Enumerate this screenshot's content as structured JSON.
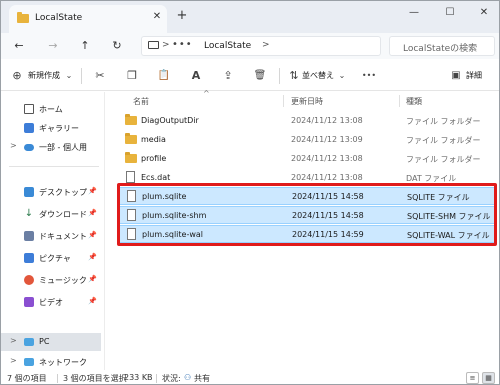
{
  "window": {
    "tab_title": "LocalState",
    "close_tab": "✕",
    "new_tab": "+",
    "minimize": "—",
    "maximize": "☐",
    "close": "✕"
  },
  "address": {
    "back": "←",
    "forward": "→",
    "up": "↑",
    "refresh": "↻",
    "overflow": "•••",
    "location": "LocalState",
    "chevron": ">",
    "search_placeholder": "LocalStateの検索"
  },
  "toolbar": {
    "new_label": "新規作成",
    "new_plus": "⊕",
    "new_caret": "⌄",
    "cut": "✂",
    "copy": "❐",
    "paste": "📋",
    "rename": "A",
    "share": "⇪",
    "delete": "🗑",
    "sort_label": "並べ替え",
    "sort_icon": "⇅",
    "more": "•••",
    "details_label": "詳細",
    "details_icon": "▣"
  },
  "sidebar": {
    "items": [
      {
        "label": "ホーム",
        "icon": "home-icon",
        "chev": ""
      },
      {
        "label": "ギャラリー",
        "icon": "gallery-icon",
        "chev": ""
      },
      {
        "label": "一部 - 個人用",
        "icon": "cloud-icon",
        "chev": ">"
      },
      {
        "label": "デスクトップ",
        "icon": "desktop-icon",
        "chev": ""
      },
      {
        "label": "ダウンロード",
        "icon": "download-icon",
        "chev": ""
      },
      {
        "label": "ドキュメント",
        "icon": "documents-icon",
        "chev": ""
      },
      {
        "label": "ピクチャ",
        "icon": "pictures-icon",
        "chev": ""
      },
      {
        "label": "ミュージック",
        "icon": "music-icon",
        "chev": ""
      },
      {
        "label": "ビデオ",
        "icon": "videos-icon",
        "chev": ""
      },
      {
        "label": "PC",
        "icon": "pc-icon",
        "chev": ">"
      },
      {
        "label": "ネットワーク",
        "icon": "network-icon",
        "chev": ">"
      }
    ],
    "pin": "📌"
  },
  "columns": {
    "name": "名前",
    "modified": "更新日時",
    "type": "種類",
    "sort_caret": "^"
  },
  "files": [
    {
      "name": "DiagOutputDir",
      "date": "2024/11/12 13:08",
      "type": "ファイル フォルダー",
      "kind": "folder"
    },
    {
      "name": "media",
      "date": "2024/11/12 13:09",
      "type": "ファイル フォルダー",
      "kind": "folder"
    },
    {
      "name": "profile",
      "date": "2024/11/12 13:08",
      "type": "ファイル フォルダー",
      "kind": "folder"
    },
    {
      "name": "Ecs.dat",
      "date": "2024/11/12 13:08",
      "type": "DAT ファイル",
      "kind": "file"
    },
    {
      "name": "plum.sqlite",
      "date": "2024/11/15 14:58",
      "type": "SQLITE ファイル",
      "kind": "file"
    },
    {
      "name": "plum.sqlite-shm",
      "date": "2024/11/15 14:58",
      "type": "SQLITE-SHM ファイル",
      "kind": "file"
    },
    {
      "name": "plum.sqlite-wal",
      "date": "2024/11/15 14:59",
      "type": "SQLITE-WAL ファイル",
      "kind": "file"
    }
  ],
  "status": {
    "item_count": "7 個の項目",
    "selected": "3 個の項目を選択",
    "size": "233 KB",
    "state_label": "状況:",
    "state_value": "共有"
  },
  "colors": {
    "selection": "#cce8ff",
    "highlight": "#e01b1b",
    "folder": "#e8b33c"
  }
}
